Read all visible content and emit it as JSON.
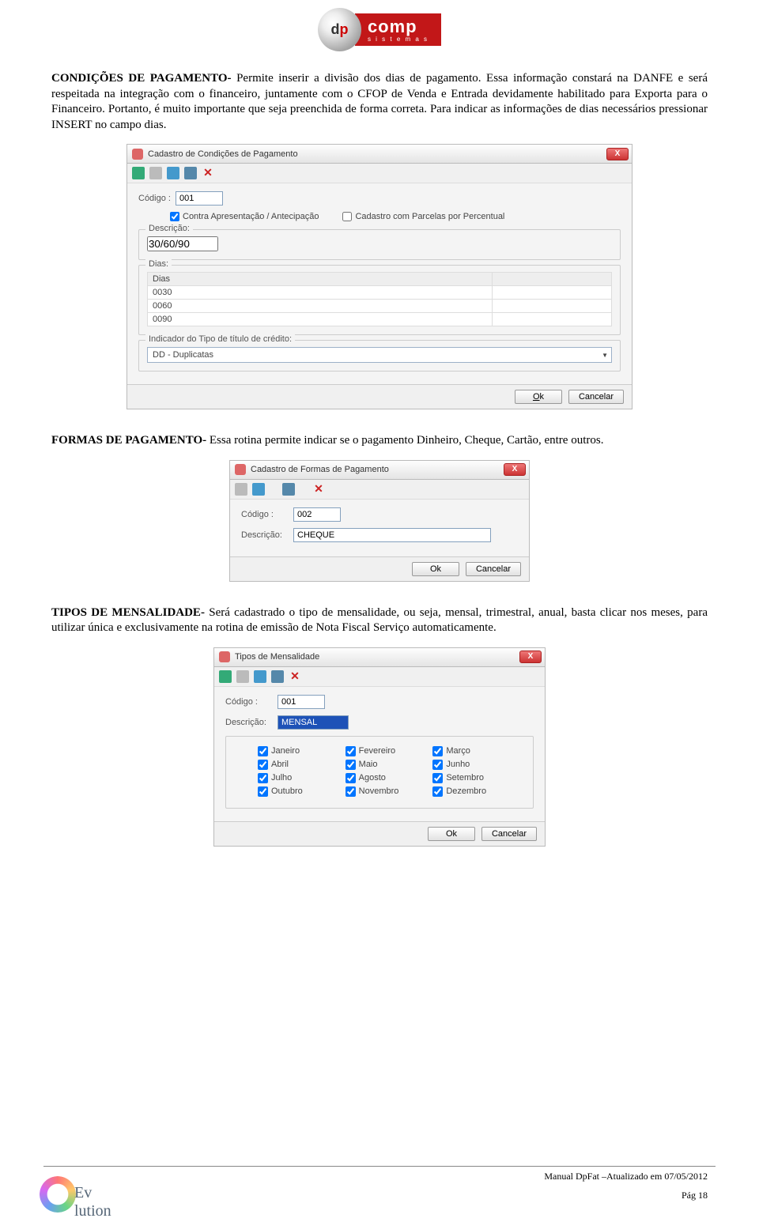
{
  "logo": {
    "dp_d": "d",
    "dp_p": "p",
    "comp": "comp",
    "sist": "s i s t e m a s"
  },
  "section1": {
    "heading": "CONDIÇÕES DE PAGAMENTO-",
    "text": " Permite inserir a divisão dos dias de pagamento. Essa informação constará na DANFE e será respeitada na integração com o financeiro, juntamente com o CFOP de Venda e Entrada devidamente habilitado para Exporta para o Financeiro. Portanto, é muito importante que seja preenchida de forma correta. Para indicar as informações de dias necessários pressionar INSERT no campo dias."
  },
  "section2": {
    "heading": "FORMAS DE PAGAMENTO-",
    "text": " Essa rotina permite indicar se o pagamento Dinheiro, Cheque, Cartão, entre outros."
  },
  "section3": {
    "heading": "TIPOS DE MENSALIDADE-",
    "text": " Será cadastrado o tipo de mensalidade, ou seja, mensal, trimestral, anual, basta clicar nos meses, para utilizar única e exclusivamente na rotina de emissão de Nota Fiscal Serviço automaticamente."
  },
  "ss1": {
    "title": "Cadastro de Condições de Pagamento",
    "codigo_label": "Código :",
    "codigo_value": "001",
    "chk1": "Contra Apresentação / Antecipação",
    "chk2": "Cadastro com Parcelas por Percentual",
    "descricao_legend": "Descrição:",
    "descricao_value": "30/60/90",
    "dias_legend": "Dias:",
    "dias_header": "Dias",
    "dias_rows": [
      "0030",
      "0060",
      "0090"
    ],
    "indicador_legend": "Indicador do Tipo de título de crédito:",
    "indicador_value": "DD - Duplicatas",
    "ok": "Ok",
    "cancel": "Cancelar"
  },
  "ss2": {
    "title": "Cadastro de Formas de Pagamento",
    "codigo_label": "Código :",
    "codigo_value": "002",
    "descricao_label": "Descrição:",
    "descricao_value": "CHEQUE",
    "ok": "Ok",
    "cancel": "Cancelar"
  },
  "ss3": {
    "title": "Tipos de Mensalidade",
    "codigo_label": "Código :",
    "codigo_value": "001",
    "descricao_label": "Descrição:",
    "descricao_value": "MENSAL",
    "months": [
      "Janeiro",
      "Fevereiro",
      "Março",
      "Abril",
      "Maio",
      "Junho",
      "Julho",
      "Agosto",
      "Setembro",
      "Outubro",
      "Novembro",
      "Dezembro"
    ],
    "ok": "Ok",
    "cancel": "Cancelar"
  },
  "footer": {
    "manual": "Manual DpFat –Atualizado em 07/05/2012",
    "page": "Pág 18",
    "evo": "Ev    lution"
  }
}
